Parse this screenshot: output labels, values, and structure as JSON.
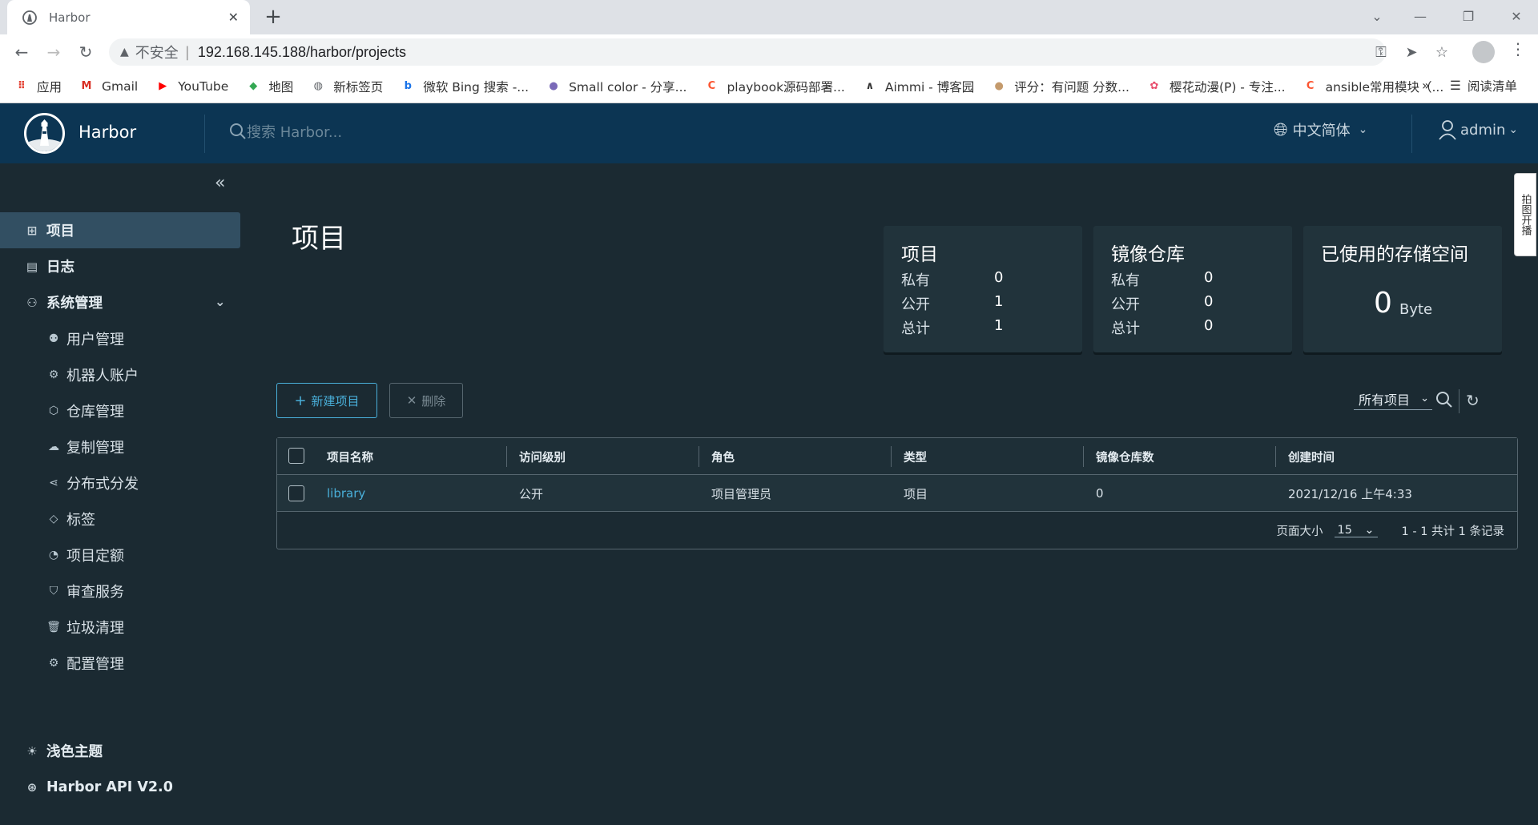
{
  "browser": {
    "tab_title": "Harbor",
    "tab_close": "✕",
    "new_tab": "+",
    "security_label": "不安全",
    "url": "192.168.145.188/harbor/projects",
    "bookmarks": [
      {
        "label": "应用",
        "icon": "apps-grid-icon",
        "color": "#e34133"
      },
      {
        "label": "Gmail",
        "icon": "gmail-icon",
        "color": "#d93025"
      },
      {
        "label": "YouTube",
        "icon": "youtube-icon",
        "color": "#ff0000"
      },
      {
        "label": "地图",
        "icon": "maps-icon",
        "color": "#34a853"
      },
      {
        "label": "新标签页",
        "icon": "globe-icon",
        "color": "#5f6368"
      },
      {
        "label": "微软 Bing 搜索 -...",
        "icon": "bing-icon",
        "color": "#1a73e8"
      },
      {
        "label": "Small color - 分享...",
        "icon": "site-icon",
        "color": "#7a6ab8"
      },
      {
        "label": "playbook源码部署...",
        "icon": "csdn-icon",
        "color": "#fc5531"
      },
      {
        "label": "Aimmi - 博客园",
        "icon": "cnblogs-icon",
        "color": "#333333"
      },
      {
        "label": "评分：有问题 分数...",
        "icon": "site-icon",
        "color": "#c49a6c"
      },
      {
        "label": "樱花动漫(P) - 专注...",
        "icon": "flower-icon",
        "color": "#e84c6b"
      },
      {
        "label": "ansible常用模块（...",
        "icon": "csdn-icon",
        "color": "#fc5531"
      }
    ],
    "bookmarks_more": "»",
    "reading_list": "阅读清单"
  },
  "header": {
    "brand": "Harbor",
    "search_placeholder": "搜索 Harbor...",
    "language": "中文简体",
    "user": "admin"
  },
  "sidebar": {
    "items": [
      {
        "label": "项目",
        "icon": "projects-icon"
      },
      {
        "label": "日志",
        "icon": "logs-icon"
      },
      {
        "label": "系统管理",
        "icon": "admin-icon"
      }
    ],
    "sub_items": [
      {
        "label": "用户管理",
        "icon": "users-icon"
      },
      {
        "label": "机器人账户",
        "icon": "robot-icon"
      },
      {
        "label": "仓库管理",
        "icon": "registry-icon"
      },
      {
        "label": "复制管理",
        "icon": "replication-icon"
      },
      {
        "label": "分布式分发",
        "icon": "share-icon"
      },
      {
        "label": "标签",
        "icon": "tag-icon"
      },
      {
        "label": "项目定额",
        "icon": "quota-icon"
      },
      {
        "label": "审查服务",
        "icon": "shield-icon"
      },
      {
        "label": "垃圾清理",
        "icon": "trash-icon"
      },
      {
        "label": "配置管理",
        "icon": "gear-icon"
      }
    ],
    "theme": "浅色主题",
    "api": "Harbor API V2.0"
  },
  "main": {
    "title": "项目",
    "cards": [
      {
        "title": "项目",
        "rows": [
          {
            "k": "私有",
            "v": "0"
          },
          {
            "k": "公开",
            "v": "1"
          },
          {
            "k": "总计",
            "v": "1"
          }
        ]
      },
      {
        "title": "镜像仓库",
        "rows": [
          {
            "k": "私有",
            "v": "0"
          },
          {
            "k": "公开",
            "v": "0"
          },
          {
            "k": "总计",
            "v": "0"
          }
        ]
      }
    ],
    "storage": {
      "title": "已使用的存储空间",
      "value": "0",
      "unit": "Byte"
    },
    "new_button": "新建项目",
    "delete_button": "删除",
    "filter": "所有项目",
    "table": {
      "columns": [
        "项目名称",
        "访问级别",
        "角色",
        "类型",
        "镜像仓库数",
        "创建时间"
      ],
      "rows": [
        [
          "library",
          "公开",
          "项目管理员",
          "项目",
          "0",
          "2021/12/16 上午4:33"
        ]
      ]
    },
    "footer": {
      "page_size_label": "页面大小",
      "page_size": "15",
      "summary": "1 - 1 共计 1 条记录"
    }
  },
  "side_tab": "拍图开播"
}
